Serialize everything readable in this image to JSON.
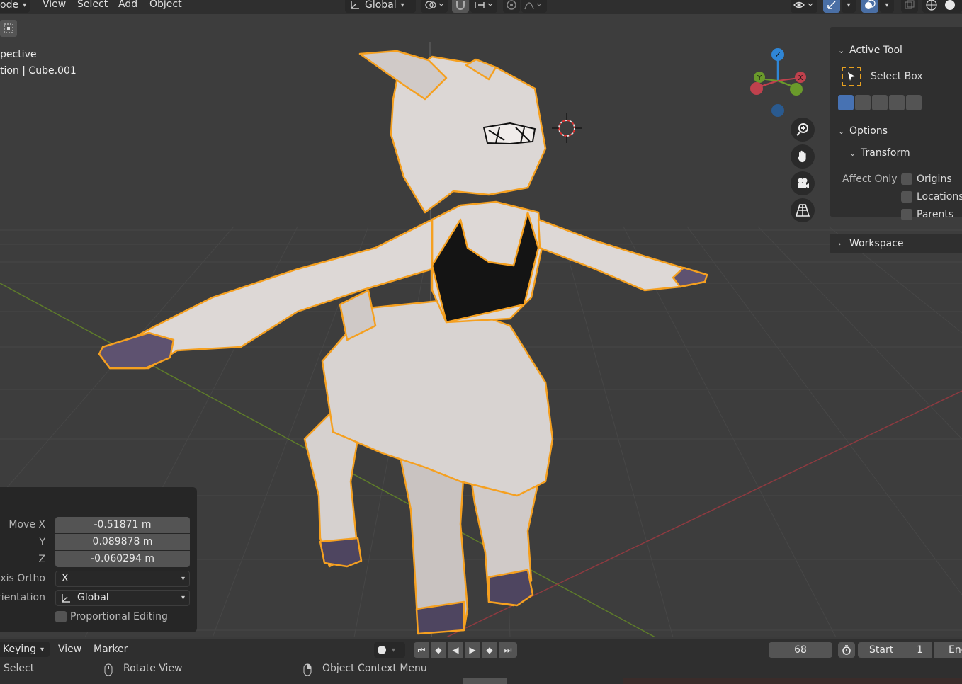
{
  "header": {
    "mode_label": "ode",
    "menu": [
      "View",
      "Select",
      "Add",
      "Object"
    ],
    "orientation": "Global"
  },
  "viewport": {
    "view_name": "pective",
    "collection_info": "tion | Cube.001"
  },
  "gizmo": {
    "z": "Z",
    "y": "Y",
    "x": "X"
  },
  "npanel": {
    "active_tool_title": "Active Tool",
    "tool_name": "Select Box",
    "options_title": "Options",
    "transform_title": "Transform",
    "affect_only_label": "Affect Only",
    "affect_origins": "Origins",
    "affect_locations": "Locations",
    "affect_parents": "Parents",
    "workspace_title": "Workspace"
  },
  "operator": {
    "move_x_label": "Move X",
    "move_x": "-0.51871 m",
    "y_label": "Y",
    "y": "0.089878 m",
    "z_label": "Z",
    "z": "-0.060294 m",
    "axis_ortho_label": "Axis Ortho",
    "axis_ortho": "X",
    "orientation_label": "rientation",
    "orientation": "Global",
    "proportional_label": "Proportional Editing"
  },
  "timeline": {
    "keying": "Keying",
    "view": "View",
    "marker": "Marker",
    "current_frame": "68",
    "start_label": "Start",
    "start_value": "1",
    "end_label": "End"
  },
  "statusbar": {
    "select": "Select",
    "rotate_view": "Rotate View",
    "context_menu": "Object Context Menu"
  },
  "colors": {
    "accent": "#4772b3",
    "selection_outline": "#f5a020",
    "x_axis": "#c0414d",
    "y_axis": "#6a9a2b",
    "z_axis": "#2f86d6"
  }
}
